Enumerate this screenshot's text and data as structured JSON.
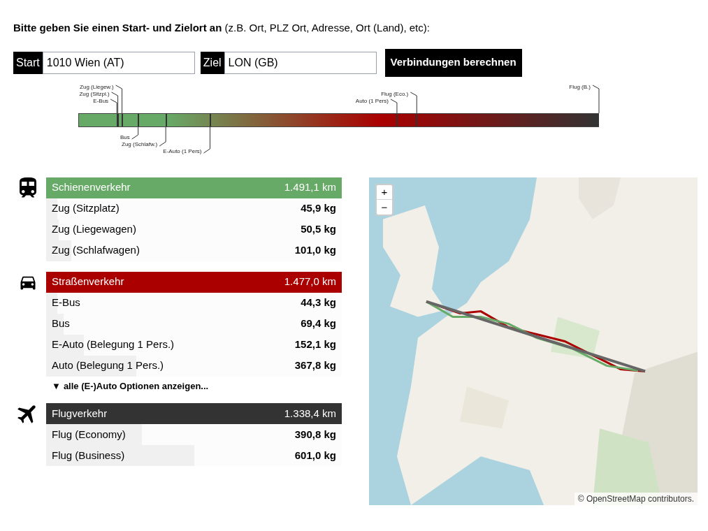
{
  "intro": "**Bitte geben Sie einen Start- und Zielort an** (z.B. Ort, PLZ Ort, Adresse, Ort (Land), etc):",
  "form": {
    "start": {
      "label": "Start",
      "value": "1010 Wien (AT)"
    },
    "destination": {
      "label": "Ziel",
      "value": "LON (GB)"
    },
    "button": "Verbindungen berechnen"
  },
  "scale": {
    "above_rows": [
      [
        {
          "label": "Zug (Liegew.)",
          "level": 0.084
        },
        {
          "label": "Flug (B.)",
          "level": 1.0
        }
      ],
      [
        {
          "label": "Zug (Sitzpl.)",
          "level": 0.076
        },
        {
          "label": "Flug (Eco.)",
          "level": 0.65
        }
      ],
      [
        {
          "label": "E-Bus",
          "level": 0.074
        },
        {
          "label": "Auto (1 Pers)",
          "level": 0.612
        }
      ]
    ],
    "below_rows": [
      [
        {
          "label": "Bus",
          "level": 0.115
        }
      ],
      [
        {
          "label": "Zug (Schlafw.)",
          "level": 0.168
        }
      ],
      [
        {
          "label": "E-Auto (1 Pers)",
          "level": 0.253
        }
      ]
    ]
  },
  "sections": [
    {
      "kind": "rail",
      "title": "Schienenverkehr",
      "distance": "1.491,1 km",
      "color": "#67aa67",
      "rows": [
        {
          "label": "Zug (Sitzplatz)",
          "value": "45,9 kg",
          "level": 0.038
        },
        {
          "label": "Zug (Liegewagen)",
          "value": "50,5 kg",
          "level": 0.042
        },
        {
          "label": "Zug (Schlafwagen)",
          "value": "101,0 kg",
          "level": 0.084
        }
      ]
    },
    {
      "kind": "road",
      "title": "Straßenverkehr",
      "distance": "1.477,0 km",
      "color": "#aa0000",
      "rows": [
        {
          "label": "E-Bus",
          "value": "44,3 kg",
          "level": 0.037
        },
        {
          "label": "Bus",
          "value": "69,4 kg",
          "level": 0.058
        },
        {
          "label": "E-Auto (Belegung 1 Pers.)",
          "value": "152,1 kg",
          "level": 0.127
        },
        {
          "label": "Auto (Belegung 1 Pers.)",
          "value": "367,8 kg",
          "level": 0.306
        }
      ],
      "more": {
        "icon": "▼",
        "label": "alle (E-)Auto Optionen anzeigen..."
      }
    },
    {
      "kind": "air",
      "title": "Flugverkehr",
      "distance": "1.338,4 km",
      "color": "#333333",
      "rows": [
        {
          "label": "Flug (Economy)",
          "value": "390,8 kg",
          "level": 0.325
        },
        {
          "label": "Flug (Business)",
          "value": "601,0 kg",
          "level": 0.5
        }
      ]
    }
  ],
  "map": {
    "zoom_in": "+",
    "zoom_out": "−",
    "attribution": "© OpenStreetMap contributors."
  }
}
